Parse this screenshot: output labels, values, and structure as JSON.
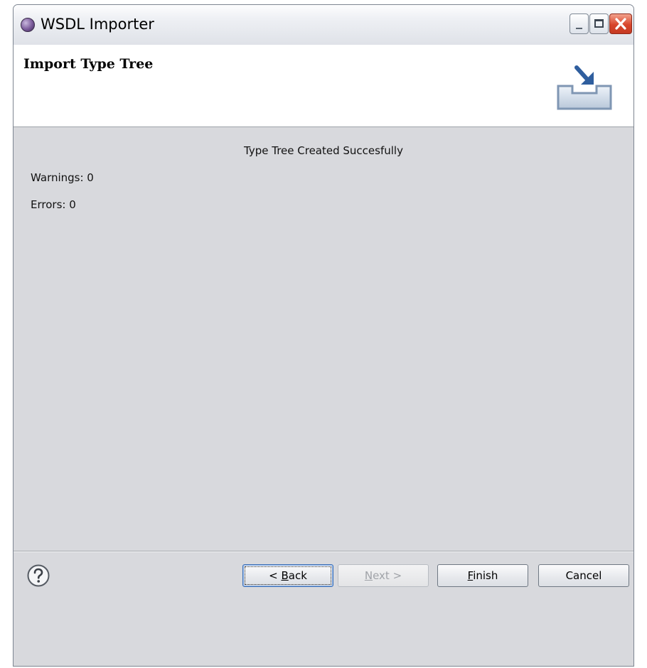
{
  "window": {
    "title": "WSDL Importer"
  },
  "header": {
    "title": "Import Type Tree"
  },
  "content": {
    "status": "Type Tree Created Succesfully",
    "warnings": "Warnings: 0",
    "errors": "Errors: 0"
  },
  "buttons": {
    "back": {
      "pre": "< ",
      "mnemonic": "B",
      "post": "ack"
    },
    "next": {
      "pre": "",
      "mnemonic": "N",
      "post": "ext >"
    },
    "finish": {
      "pre": "",
      "mnemonic": "F",
      "post": "inish"
    },
    "cancel": {
      "label": "Cancel"
    }
  },
  "colors": {
    "dialog_background": "#d8d9dd",
    "close_button": "#d8452b"
  },
  "icons": {
    "app": "eclipse-app-icon",
    "wizard": "import-wizard-icon",
    "help": "help-question-icon"
  }
}
